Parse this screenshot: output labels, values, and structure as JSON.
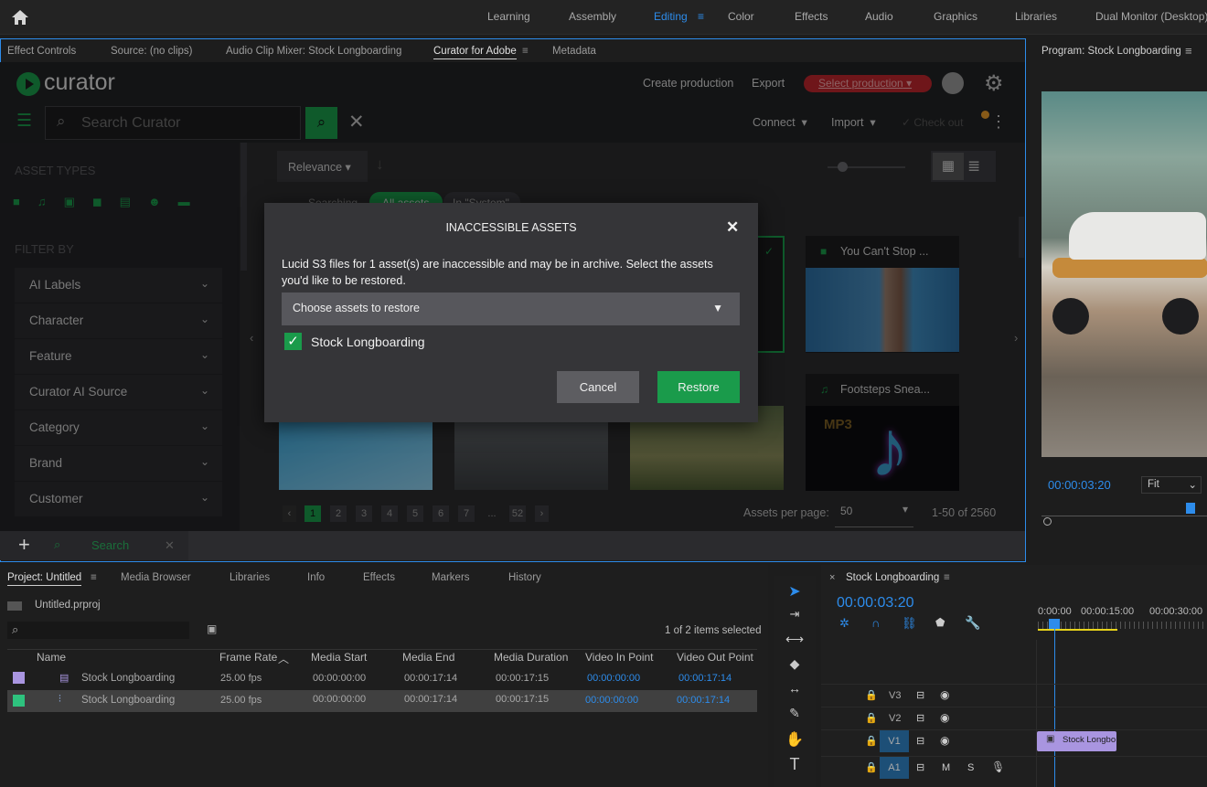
{
  "workspaces": [
    "Learning",
    "Assembly",
    "Editing",
    "Color",
    "Effects",
    "Audio",
    "Graphics",
    "Libraries",
    "Dual Monitor (Desktop)"
  ],
  "active_workspace": "Editing",
  "source_tabs": [
    "Effect Controls",
    "Source: (no clips)",
    "Audio Clip Mixer: Stock Longboarding",
    "Curator for Adobe",
    "Metadata"
  ],
  "curator": {
    "logo": "curator",
    "header": {
      "create_production": "Create production",
      "export": "Export",
      "select_production": "Select production"
    },
    "search": {
      "placeholder": "Search Curator"
    },
    "toolbar": {
      "connect": "Connect",
      "import": "Import",
      "check_out": "Check out"
    },
    "sort": "Relevance",
    "searching": "Searching",
    "scope_all": "All assets",
    "scope_system": "In \"System\"",
    "asset_types_label": "ASSET TYPES",
    "filter_by_label": "FILTER BY",
    "filters": [
      "AI Labels",
      "Character",
      "Feature",
      "Curator AI Source",
      "Category",
      "Brand",
      "Customer"
    ],
    "cards": [
      {
        "title": "You Can't Stop ...",
        "type": "video"
      },
      {
        "title": "Footsteps Snea...",
        "type": "audio"
      }
    ],
    "audio_badge": "MP3",
    "pagination": {
      "pages": [
        "1",
        "2",
        "3",
        "4",
        "5",
        "6",
        "7",
        "...",
        "52"
      ],
      "current": "1"
    },
    "assets_per_page_label": "Assets per page:",
    "assets_per_page": "50",
    "range": "1-50 of 2560",
    "bottom_search_label": "Search"
  },
  "modal": {
    "title": "INACCESSIBLE ASSETS",
    "message": "Lucid S3 files for 1 asset(s) are inaccessible and may be in archive. Select the assets you'd like to be restored.",
    "dropdown_label": "Choose assets to restore",
    "asset": "Stock Longboarding",
    "cancel": "Cancel",
    "restore": "Restore"
  },
  "program": {
    "title": "Program: Stock Longboarding",
    "timecode": "00:00:03:20",
    "fit": "Fit"
  },
  "project": {
    "tabs": [
      "Project: Untitled",
      "Media Browser",
      "Libraries",
      "Info",
      "Effects",
      "Markers",
      "History"
    ],
    "file": "Untitled.prproj",
    "selection": "1 of 2 items selected",
    "columns": [
      "Name",
      "Frame Rate",
      "Media Start",
      "Media End",
      "Media Duration",
      "Video In Point",
      "Video Out Point"
    ],
    "rows": [
      {
        "name": "Stock Longboarding",
        "frame_rate": "25.00 fps",
        "media_start": "00:00:00:00",
        "media_end": "00:00:17:14",
        "duration": "00:00:17:15",
        "in": "00:00:00:00",
        "out": "00:00:17:14",
        "color": "#a995e0"
      },
      {
        "name": "Stock Longboarding",
        "frame_rate": "25.00 fps",
        "media_start": "00:00:00:00",
        "media_end": "00:00:17:14",
        "duration": "00:00:17:15",
        "in": "00:00:00:00",
        "out": "00:00:17:14",
        "color": "#2ec27e"
      }
    ]
  },
  "timeline": {
    "title": "Stock Longboarding",
    "timecode": "00:00:03:20",
    "ruler": [
      "0:00:00",
      "00:00:15:00",
      "00:00:30:00"
    ],
    "tracks": [
      "V3",
      "V2",
      "V1",
      "A1"
    ],
    "clip": "Stock Longbo",
    "mute": "M",
    "solo": "S"
  },
  "colors": {
    "accent": "#1a9b4b",
    "blue": "#2d8ceb",
    "danger": "#c0262d"
  }
}
